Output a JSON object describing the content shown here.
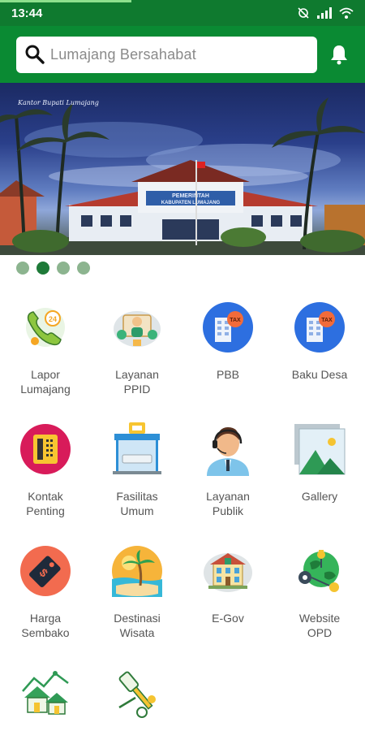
{
  "status_bar": {
    "time": "13:44",
    "icons": [
      "mute-icon",
      "signal-icon",
      "wifi-icon"
    ],
    "load_progress": 0.36
  },
  "search": {
    "placeholder": "Lumajang Bersahabat"
  },
  "banner": {
    "caption": "Kantor Bupati Lumajang",
    "building_sign_line1": "PEMERINTAH",
    "building_sign_line2": "KABUPATEN LUMAJANG"
  },
  "pager": {
    "count": 4,
    "active_index": 1
  },
  "menu": [
    {
      "label": "Lapor\nLumajang",
      "icon": "phone-report-icon"
    },
    {
      "label": "Layanan\nPPID",
      "icon": "ppid-service-icon"
    },
    {
      "label": "PBB",
      "icon": "tax-building-icon"
    },
    {
      "label": "Baku Desa",
      "icon": "tax-building-icon"
    },
    {
      "label": "Kontak\nPenting",
      "icon": "contact-phone-icon"
    },
    {
      "label": "Fasilitas\nUmum",
      "icon": "bus-stop-icon"
    },
    {
      "label": "Layanan\nPublik",
      "icon": "call-center-agent-icon"
    },
    {
      "label": "Gallery",
      "icon": "picture-icon"
    },
    {
      "label": "Harga\nSembako",
      "icon": "price-tag-icon"
    },
    {
      "label": "Destinasi\nWisata",
      "icon": "beach-icon"
    },
    {
      "label": "E-Gov",
      "icon": "government-building-icon"
    },
    {
      "label": "Website\nOPD",
      "icon": "globe-network-icon"
    },
    {
      "label": "",
      "icon": "village-icon"
    },
    {
      "label": "",
      "icon": "law-gavel-icon"
    }
  ],
  "colors": {
    "header": "#0a8a33",
    "status_bar": "#0f7a2f",
    "dot_active": "#1e7a38",
    "dot_inactive": "#8cb48f"
  }
}
